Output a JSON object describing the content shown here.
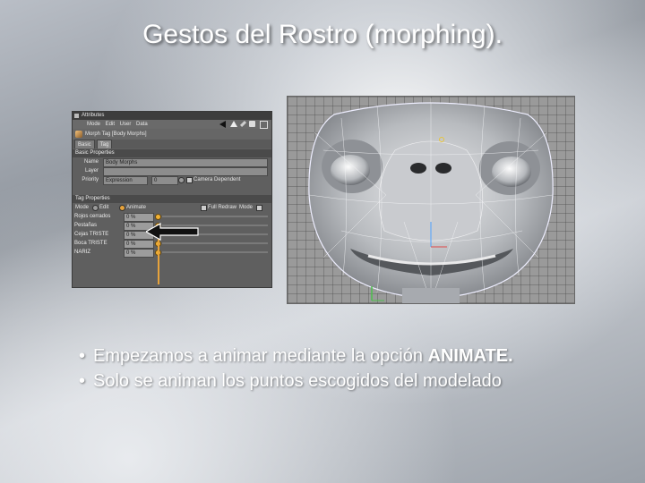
{
  "slide": {
    "title": "Gestos del Rostro (morphing)."
  },
  "attribute_panel": {
    "window_title": "Attributes",
    "menu_text": "Mode  Edit  User Data",
    "object_label": "Morph Tag [Body Morphs]",
    "tabs": [
      "Basic",
      "Tag"
    ],
    "basic_properties": {
      "header": "Basic Properties",
      "name_label": "Name",
      "name_value": "Body Morphs",
      "layer_label": "Layer",
      "layer_value": "",
      "priority_label": "Priority",
      "priority_value": "Expression",
      "priority_number": "0",
      "camera_dependent_label": "Camera Dependent"
    },
    "tag_properties": {
      "header": "Tag Properties",
      "mode_label": "Mode",
      "mode_edit": "Edit",
      "mode_animate": "Animate",
      "full_redraw_label": "Full Redraw",
      "mode2_label": "Mode"
    },
    "morph_sliders": [
      {
        "label": "Rojos cerrados",
        "value": "0 %"
      },
      {
        "label": "Pestañas",
        "value": "0 %"
      },
      {
        "label": "Cejas TRISTE",
        "value": "0 %"
      },
      {
        "label": "Boca TRISTE",
        "value": "0 %"
      },
      {
        "label": "NARIZ",
        "value": "0 %"
      }
    ],
    "accent_color": "#e7a33b"
  },
  "viewport": {
    "background": "#9a9a9a",
    "model_color": "#d8dadc"
  },
  "bullets": [
    {
      "lead": "Empezamos a animar mediante la opción ",
      "strong": "ANIMATE."
    },
    {
      "lead": "Solo se animan los puntos escogidos del modelado",
      "strong": ""
    }
  ]
}
